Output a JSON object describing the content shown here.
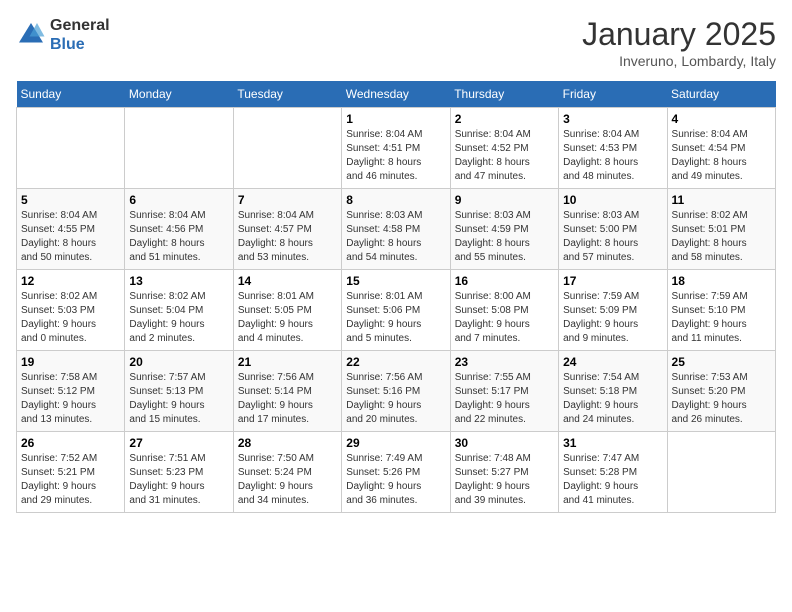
{
  "header": {
    "logo_general": "General",
    "logo_blue": "Blue",
    "title": "January 2025",
    "subtitle": "Inveruno, Lombardy, Italy"
  },
  "weekdays": [
    "Sunday",
    "Monday",
    "Tuesday",
    "Wednesday",
    "Thursday",
    "Friday",
    "Saturday"
  ],
  "weeks": [
    [
      {
        "day": "",
        "info": ""
      },
      {
        "day": "",
        "info": ""
      },
      {
        "day": "",
        "info": ""
      },
      {
        "day": "1",
        "info": "Sunrise: 8:04 AM\nSunset: 4:51 PM\nDaylight: 8 hours\nand 46 minutes."
      },
      {
        "day": "2",
        "info": "Sunrise: 8:04 AM\nSunset: 4:52 PM\nDaylight: 8 hours\nand 47 minutes."
      },
      {
        "day": "3",
        "info": "Sunrise: 8:04 AM\nSunset: 4:53 PM\nDaylight: 8 hours\nand 48 minutes."
      },
      {
        "day": "4",
        "info": "Sunrise: 8:04 AM\nSunset: 4:54 PM\nDaylight: 8 hours\nand 49 minutes."
      }
    ],
    [
      {
        "day": "5",
        "info": "Sunrise: 8:04 AM\nSunset: 4:55 PM\nDaylight: 8 hours\nand 50 minutes."
      },
      {
        "day": "6",
        "info": "Sunrise: 8:04 AM\nSunset: 4:56 PM\nDaylight: 8 hours\nand 51 minutes."
      },
      {
        "day": "7",
        "info": "Sunrise: 8:04 AM\nSunset: 4:57 PM\nDaylight: 8 hours\nand 53 minutes."
      },
      {
        "day": "8",
        "info": "Sunrise: 8:03 AM\nSunset: 4:58 PM\nDaylight: 8 hours\nand 54 minutes."
      },
      {
        "day": "9",
        "info": "Sunrise: 8:03 AM\nSunset: 4:59 PM\nDaylight: 8 hours\nand 55 minutes."
      },
      {
        "day": "10",
        "info": "Sunrise: 8:03 AM\nSunset: 5:00 PM\nDaylight: 8 hours\nand 57 minutes."
      },
      {
        "day": "11",
        "info": "Sunrise: 8:02 AM\nSunset: 5:01 PM\nDaylight: 8 hours\nand 58 minutes."
      }
    ],
    [
      {
        "day": "12",
        "info": "Sunrise: 8:02 AM\nSunset: 5:03 PM\nDaylight: 9 hours\nand 0 minutes."
      },
      {
        "day": "13",
        "info": "Sunrise: 8:02 AM\nSunset: 5:04 PM\nDaylight: 9 hours\nand 2 minutes."
      },
      {
        "day": "14",
        "info": "Sunrise: 8:01 AM\nSunset: 5:05 PM\nDaylight: 9 hours\nand 4 minutes."
      },
      {
        "day": "15",
        "info": "Sunrise: 8:01 AM\nSunset: 5:06 PM\nDaylight: 9 hours\nand 5 minutes."
      },
      {
        "day": "16",
        "info": "Sunrise: 8:00 AM\nSunset: 5:08 PM\nDaylight: 9 hours\nand 7 minutes."
      },
      {
        "day": "17",
        "info": "Sunrise: 7:59 AM\nSunset: 5:09 PM\nDaylight: 9 hours\nand 9 minutes."
      },
      {
        "day": "18",
        "info": "Sunrise: 7:59 AM\nSunset: 5:10 PM\nDaylight: 9 hours\nand 11 minutes."
      }
    ],
    [
      {
        "day": "19",
        "info": "Sunrise: 7:58 AM\nSunset: 5:12 PM\nDaylight: 9 hours\nand 13 minutes."
      },
      {
        "day": "20",
        "info": "Sunrise: 7:57 AM\nSunset: 5:13 PM\nDaylight: 9 hours\nand 15 minutes."
      },
      {
        "day": "21",
        "info": "Sunrise: 7:56 AM\nSunset: 5:14 PM\nDaylight: 9 hours\nand 17 minutes."
      },
      {
        "day": "22",
        "info": "Sunrise: 7:56 AM\nSunset: 5:16 PM\nDaylight: 9 hours\nand 20 minutes."
      },
      {
        "day": "23",
        "info": "Sunrise: 7:55 AM\nSunset: 5:17 PM\nDaylight: 9 hours\nand 22 minutes."
      },
      {
        "day": "24",
        "info": "Sunrise: 7:54 AM\nSunset: 5:18 PM\nDaylight: 9 hours\nand 24 minutes."
      },
      {
        "day": "25",
        "info": "Sunrise: 7:53 AM\nSunset: 5:20 PM\nDaylight: 9 hours\nand 26 minutes."
      }
    ],
    [
      {
        "day": "26",
        "info": "Sunrise: 7:52 AM\nSunset: 5:21 PM\nDaylight: 9 hours\nand 29 minutes."
      },
      {
        "day": "27",
        "info": "Sunrise: 7:51 AM\nSunset: 5:23 PM\nDaylight: 9 hours\nand 31 minutes."
      },
      {
        "day": "28",
        "info": "Sunrise: 7:50 AM\nSunset: 5:24 PM\nDaylight: 9 hours\nand 34 minutes."
      },
      {
        "day": "29",
        "info": "Sunrise: 7:49 AM\nSunset: 5:26 PM\nDaylight: 9 hours\nand 36 minutes."
      },
      {
        "day": "30",
        "info": "Sunrise: 7:48 AM\nSunset: 5:27 PM\nDaylight: 9 hours\nand 39 minutes."
      },
      {
        "day": "31",
        "info": "Sunrise: 7:47 AM\nSunset: 5:28 PM\nDaylight: 9 hours\nand 41 minutes."
      },
      {
        "day": "",
        "info": ""
      }
    ]
  ]
}
